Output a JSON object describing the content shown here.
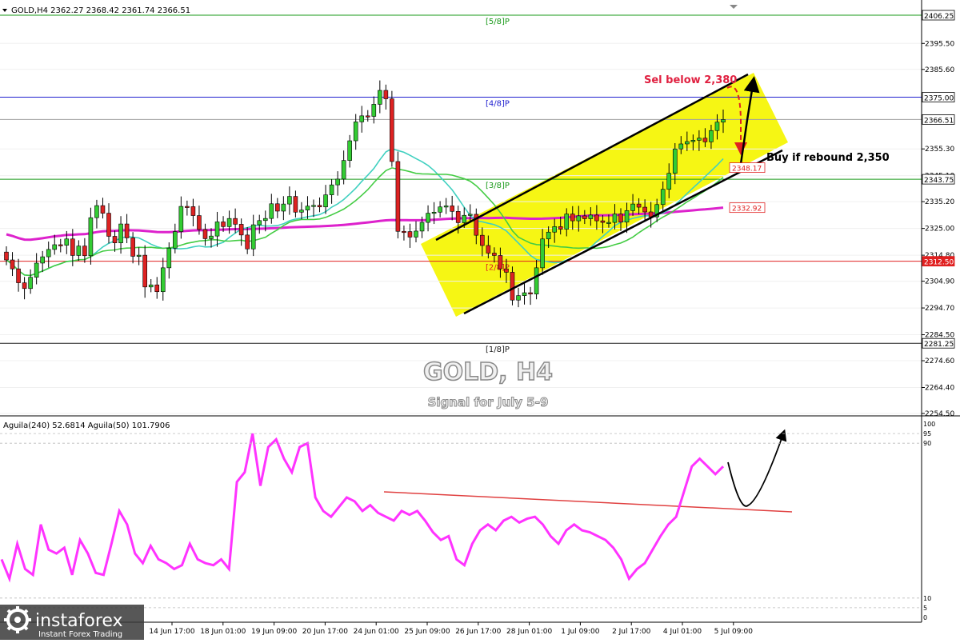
{
  "header": {
    "symbol_info": "GOLD,H4  2362.27 2368.42 2361.74 2366.51",
    "indicator_info": "Aguila(240) 52.6814  Aguila(50) 101.7906"
  },
  "overlay": {
    "title": "GOLD, H4",
    "subtitle": "Signal for July 5-9"
  },
  "annotations": {
    "sell": "Sel below 2,380",
    "buy": "Buy if rebound 2,350"
  },
  "murrey_levels": [
    {
      "label": "[5/8]P",
      "value": 2406.25,
      "color": "#1a9a1a",
      "box": "2406.25"
    },
    {
      "label": "[4/8]P",
      "value": 2375.0,
      "color": "#2020d0",
      "box": "2375.00"
    },
    {
      "label": "[3/8]P",
      "value": 2343.75,
      "color": "#1a9a1a",
      "box": "2343.75"
    },
    {
      "label": "[2/8]P",
      "value": 2312.5,
      "color": "#e02020",
      "box": "2312.50"
    },
    {
      "label": "[1/8]P",
      "value": 2281.25,
      "color": "#202020",
      "box": "2281.25"
    }
  ],
  "price_boxes": [
    {
      "text": "2366.51",
      "value": 2366.51
    },
    {
      "text": "2348.17",
      "value": 2348.17
    },
    {
      "text": "2332.92",
      "value": 2332.92
    }
  ],
  "chart_data": [
    {
      "type": "candlestick",
      "title": "GOLD, H4",
      "subtitle": "Signal for July 5-9",
      "y_ticks": [
        2395.5,
        2385.6,
        2355.3,
        2345.1,
        2335.2,
        2325.0,
        2314.8,
        2304.9,
        2294.7,
        2284.5,
        2274.6,
        2264.4,
        2254.5
      ],
      "y_tick_labels": [
        "2395.50",
        "2385.60",
        "2355.30",
        "2345.10",
        "2335.20",
        "2325.00",
        "2314.80",
        "2304.90",
        "2294.70",
        "2284.50",
        "2274.60",
        "2264.40",
        "2254.50"
      ],
      "ylim": [
        2250.0,
        2411.5
      ],
      "x_tick_labels": [
        "14 Jun 17:00",
        "18 Jun 01:00",
        "19 Jun 09:00",
        "20 Jun 17:00",
        "24 Jun 01:00",
        "25 Jun 09:00",
        "26 Jun 17:00",
        "28 Jun 01:00",
        "1 Jul 09:00",
        "2 Jul 17:00",
        "4 Jul 01:00",
        "5 Jul 09:00"
      ],
      "candle_closes": [
        2313.0,
        2309.6,
        2304.3,
        2302.1,
        2306.4,
        2311.8,
        2314.2,
        2317.0,
        2318.8,
        2318.6,
        2321.0,
        2314.7,
        2318.3,
        2314.6,
        2329.1,
        2333.7,
        2330.8,
        2322.0,
        2319.5,
        2326.7,
        2321.4,
        2314.4,
        2314.8,
        2302.7,
        2303.5,
        2300.9,
        2310.0,
        2317.5,
        2323.8,
        2333.4,
        2333.3,
        2329.9,
        2324.6,
        2321.1,
        2322.1,
        2327.5,
        2325.7,
        2328.8,
        2326.6,
        2322.5,
        2317.2,
        2326.4,
        2328.0,
        2328.8,
        2334.4,
        2331.6,
        2334.3,
        2337.2,
        2331.2,
        2332.0,
        2333.5,
        2333.8,
        2333.2,
        2337.8,
        2341.6,
        2343.8,
        2350.9,
        2358.4,
        2365.6,
        2367.9,
        2367.7,
        2372.3,
        2377.6,
        2374.4,
        2350.5,
        2323.9,
        2323.8,
        2321.7,
        2324.0,
        2327.3,
        2330.8,
        2331.2,
        2333.2,
        2333.6,
        2331.5,
        2327.2,
        2330.0,
        2330.4,
        2322.4,
        2318.5,
        2315.6,
        2314.7,
        2309.6,
        2308.3,
        2297.7,
        2299.4,
        2300.5,
        2300.0,
        2310.0,
        2321.0,
        2323.6,
        2325.7,
        2324.7,
        2330.5,
        2327.9,
        2329.8,
        2328.7,
        2330.1,
        2327.9,
        2327.3,
        2327.3,
        2330.5,
        2327.4,
        2331.8,
        2334.3,
        2333.1,
        2331.3,
        2329.4,
        2334.1,
        2339.9,
        2346.0,
        2355.3,
        2357.2,
        2358.1,
        2358.6,
        2359.4,
        2358.0,
        2362.3,
        2365.5,
        2366.5
      ],
      "series": [
        {
          "name": "Aguila(240)",
          "value": 52.6814
        },
        {
          "name": "Aguila(50)",
          "value": 101.7906
        }
      ]
    },
    {
      "type": "line",
      "title": "Aguila(240) 52.6814  Aguila(50) 101.7906",
      "ylim": [
        0,
        100
      ],
      "y_ticks": [
        0,
        5,
        10,
        90,
        95,
        100
      ],
      "values": [
        30,
        20,
        38,
        25,
        22,
        48,
        35,
        33,
        36,
        22,
        40,
        33,
        23,
        22,
        38,
        55,
        48,
        33,
        28,
        37,
        30,
        28,
        25,
        27,
        38,
        30,
        28,
        27,
        30,
        25,
        70,
        75,
        95,
        68,
        88,
        92,
        82,
        75,
        88,
        90,
        62,
        55,
        52,
        57,
        62,
        60,
        55,
        58,
        54,
        52,
        50,
        55,
        53,
        55,
        50,
        44,
        40,
        42,
        30,
        27,
        38,
        45,
        48,
        45,
        50,
        52,
        49,
        51,
        52,
        48,
        42,
        38,
        45,
        48,
        45,
        44,
        42,
        40,
        36,
        30,
        20,
        25,
        28,
        35,
        42,
        48,
        52,
        65,
        78,
        82,
        78,
        74,
        78
      ]
    }
  ]
}
